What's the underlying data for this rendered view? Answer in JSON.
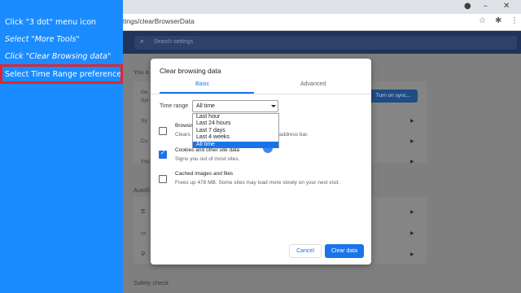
{
  "tutorial": {
    "steps": [
      "Click \"3 dot\" menu icon",
      "Select \"More Tools\"",
      "Click \"Clear Browsing data\"",
      "Select Time Range preference"
    ]
  },
  "browser": {
    "url": "tings/clearBrowserData"
  },
  "settings": {
    "search_placeholder": "Search settings",
    "you_label": "You a",
    "row1_text_a": "Ge",
    "row1_text_b": "Syr",
    "sync_button": "Turn on sync...",
    "row_sy": "Sy",
    "row_cu": "Cu",
    "row_im": "Imp",
    "autofill_label": "Autofi",
    "safety_check_label": "Safety check"
  },
  "dialog": {
    "title": "Clear browsing data",
    "tabs": [
      "Basic",
      "Advanced"
    ],
    "time_range_label": "Time range",
    "time_range_value": "All time",
    "time_range_options": [
      "Last hour",
      "Last 24 hours",
      "Last 7 days",
      "Last 4 weeks",
      "All time"
    ],
    "options": [
      {
        "title": "Browsin",
        "desc": "Clears",
        "desc_tail": "address bar.",
        "checked": false
      },
      {
        "title": "Cookies and other site data",
        "desc": "Signs you out of most sites.",
        "checked": true
      },
      {
        "title": "Cached images and files",
        "desc": "Frees up 478 MB. Some sites may load more slowly on your next visit.",
        "checked": false
      }
    ],
    "cancel_button": "Cancel",
    "clear_button": "Clear data"
  },
  "colors": {
    "tutorial_bg": "#1a8cff",
    "highlight_box": "#e0262c",
    "accent": "#1a73e8"
  }
}
